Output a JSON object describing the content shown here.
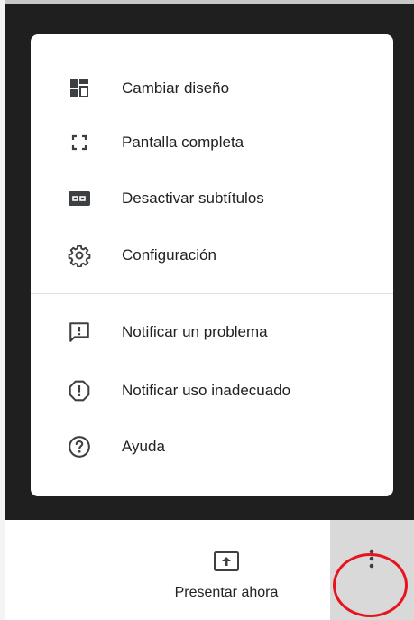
{
  "menu": {
    "items": [
      {
        "label": "Cambiar diseño",
        "icon": "change-layout-icon"
      },
      {
        "label": "Pantalla completa",
        "icon": "fullscreen-icon"
      },
      {
        "label": "Desactivar subtítulos",
        "icon": "closed-captions-icon"
      },
      {
        "label": "Configuración",
        "icon": "gear-icon"
      },
      {
        "label": "Notificar un problema",
        "icon": "report-problem-icon"
      },
      {
        "label": "Notificar uso inadecuado",
        "icon": "report-abuse-icon"
      },
      {
        "label": "Ayuda",
        "icon": "help-icon"
      }
    ]
  },
  "bottom_bar": {
    "present_label": "Presentar ahora",
    "present_icon": "present-screen-icon",
    "more_icon": "more-vert-icon"
  },
  "annotation": {
    "highlight_color": "#e8141d"
  }
}
